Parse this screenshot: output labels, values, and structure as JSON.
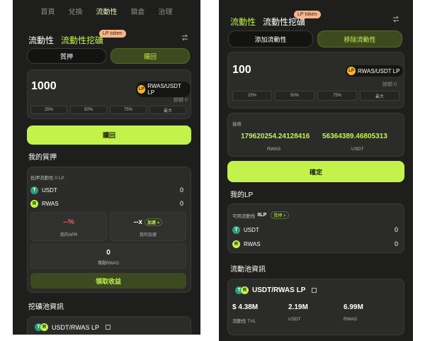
{
  "left": {
    "nav": [
      "首頁",
      "兌換",
      "流動性",
      "治理"
    ],
    "nav_active": "流動性",
    "nav_extra": "鎖倉",
    "title": "流動性",
    "title_active": "流動性挖礦",
    "badge": "LP token",
    "tabs": [
      "質押",
      "贖回"
    ],
    "amount": "1000",
    "token": "RWAS/USDT LP",
    "token_icon": "LP",
    "balance": "餘額 0",
    "pcts": [
      "25%",
      "50%",
      "75%",
      "最大"
    ],
    "action": "贖回",
    "my_stake_title": "我的質押",
    "stake_label": "抵押流動性 0 LP",
    "tokens": [
      {
        "symbol": "USDT",
        "value": "0"
      },
      {
        "symbol": "RWAS",
        "value": "0"
      }
    ],
    "apr_value": "--%",
    "apr_label": "我的APR",
    "boost_value": "--x",
    "boost_tag": "加速 >",
    "boost_label": "我的加速",
    "reward_value": "0",
    "reward_label": "獎勵RWAS",
    "claim": "領取收益",
    "pool_title": "挖礦池資訊",
    "pool_name": "USDT/RWAS LP"
  },
  "right": {
    "title_active": "流動性",
    "title": "流動性挖礦",
    "badge": "LP token",
    "tabs": [
      "添加流動性",
      "移除流動性"
    ],
    "amount": "100",
    "token": "RWAS/USDT LP",
    "token_icon": "LP",
    "balance": "餘額 0",
    "pcts": [
      "25%",
      "50%",
      "75%",
      "最大"
    ],
    "receive_label": "接收",
    "receive": [
      {
        "value": "179620254.24128416",
        "symbol": "RWAS"
      },
      {
        "value": "56364389.46805313",
        "symbol": "USDT"
      }
    ],
    "confirm": "確定",
    "mylp_title": "我的LP",
    "lp_label": "可用流動性",
    "lp_value": "0LP",
    "lp_tag": "質押 >",
    "tokens": [
      {
        "symbol": "USDT",
        "value": "0"
      },
      {
        "symbol": "RWAS",
        "value": "0"
      }
    ],
    "pool_title": "流動池資訊",
    "pool_name": "USDT/RWAS LP",
    "stats": [
      {
        "value": "$ 4.38M",
        "label": "流動性 TVL"
      },
      {
        "value": "2.19M",
        "label": "USDT"
      },
      {
        "value": "6.99M",
        "label": "RWAS"
      }
    ]
  },
  "colors": {
    "accent": "#c3f34a",
    "panel": "#1e1f1c",
    "badge": "#f8b58a",
    "usdt": "#26a17b"
  }
}
